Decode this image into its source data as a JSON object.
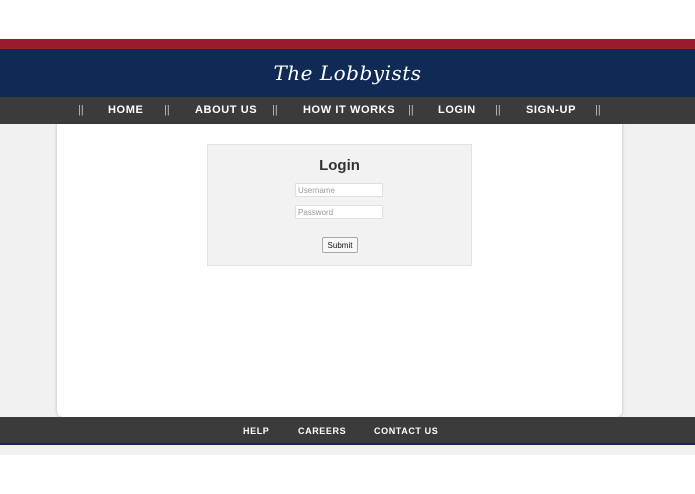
{
  "header": {
    "site_title": "The Lobbyists"
  },
  "nav": {
    "separator": "||",
    "items": [
      {
        "label": "HOME"
      },
      {
        "label": "ABOUT US"
      },
      {
        "label": "HOW IT WORKS"
      },
      {
        "label": "LOGIN"
      },
      {
        "label": "SIGN-UP"
      }
    ]
  },
  "login": {
    "title": "Login",
    "username_placeholder": "Username",
    "password_placeholder": "Password",
    "submit_label": "Submit"
  },
  "footer": {
    "items": [
      {
        "label": "HELP"
      },
      {
        "label": "CAREERS"
      },
      {
        "label": "CONTACT US"
      }
    ]
  },
  "colors": {
    "brand_red": "#9b1b2e",
    "brand_navy": "#0f2a55",
    "nav_bg": "#3b3b3b"
  }
}
